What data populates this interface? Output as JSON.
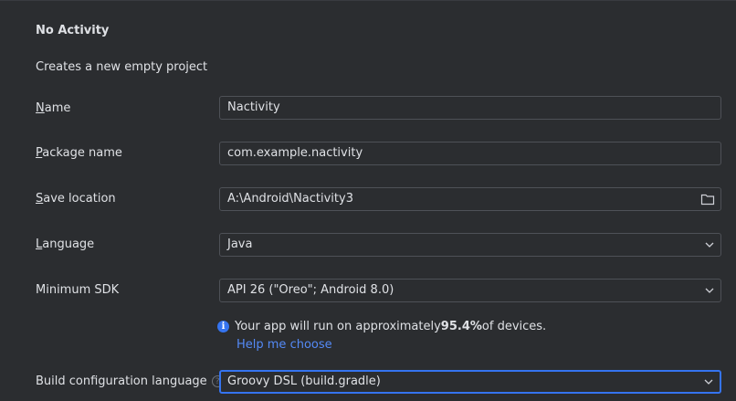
{
  "header": {
    "title": "No Activity",
    "description": "Creates a new empty project"
  },
  "form": {
    "name": {
      "label_first": "N",
      "label_rest": "ame",
      "value": "Nactivity"
    },
    "package": {
      "label_first": "P",
      "label_rest": "ackage name",
      "value": "com.example.nactivity"
    },
    "save_location": {
      "label_first": "S",
      "label_rest": "ave location",
      "value": "A:\\Android\\Nactivity3",
      "icon": "folder-icon"
    },
    "language": {
      "label_first": "L",
      "label_rest": "anguage",
      "value": "Java",
      "icon": "chevron-down-icon"
    },
    "min_sdk": {
      "label": "Minimum SDK",
      "value": "API 26 (\"Oreo\"; Android 8.0)",
      "icon": "chevron-down-icon"
    },
    "sdk_info": {
      "text_before": "Your app will run on approximately ",
      "percent": "95.4%",
      "text_after": " of devices.",
      "link": "Help me choose"
    },
    "build_config": {
      "label": "Build configuration language",
      "value": "Groovy DSL (build.gradle)",
      "icon": "chevron-down-icon"
    }
  },
  "colors": {
    "background": "#2b2d30",
    "accent": "#3574f0",
    "link": "#548af7",
    "border": "#4e5157"
  }
}
